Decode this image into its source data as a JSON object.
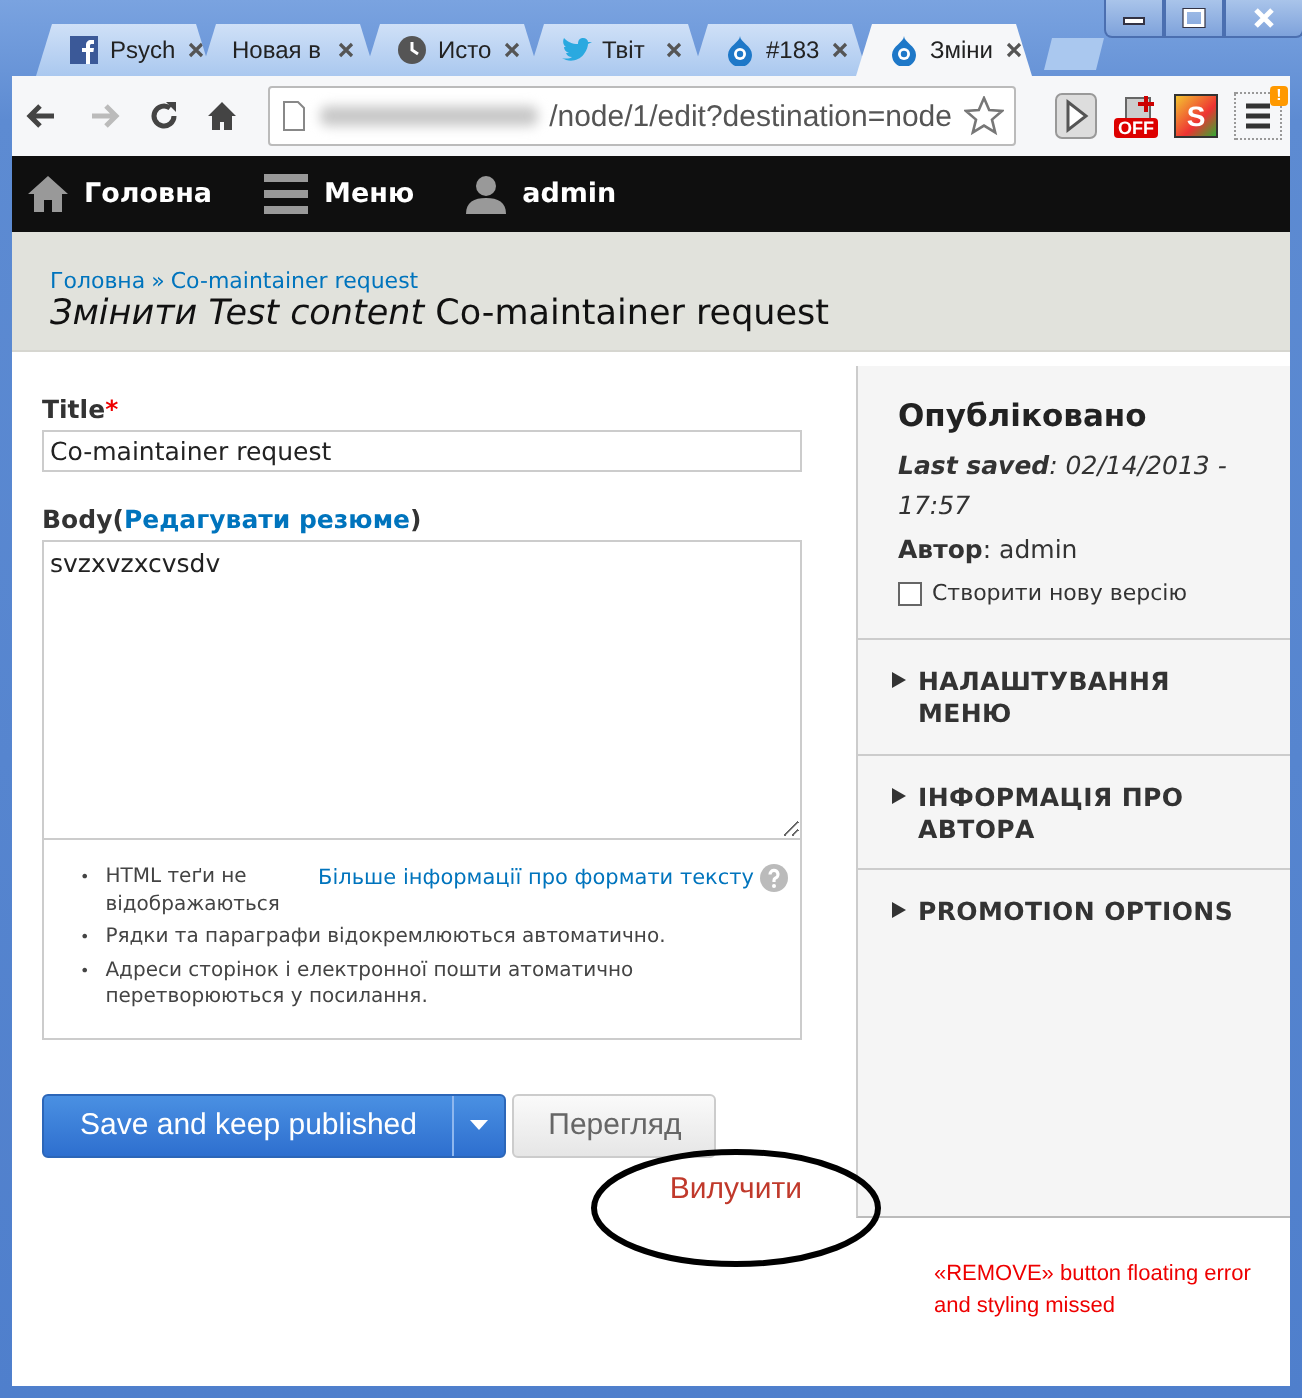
{
  "tabs": [
    {
      "label": "Psych",
      "kind": "facebook",
      "selected": false
    },
    {
      "label": "Новая в",
      "kind": "plain",
      "selected": false
    },
    {
      "label": "Исто",
      "kind": "clock",
      "selected": false
    },
    {
      "label": "Твіт",
      "kind": "bird",
      "selected": false
    },
    {
      "label": "#183",
      "kind": "drop",
      "selected": false
    },
    {
      "label": "Зміни",
      "kind": "drop",
      "selected": true
    }
  ],
  "nav": [
    {
      "kind": "back",
      "disabled": false
    },
    {
      "kind": "forward",
      "disabled": true
    },
    {
      "kind": "reload",
      "disabled": false
    },
    {
      "kind": "home",
      "disabled": false
    }
  ],
  "address": {
    "value": "/node/1/edit?destination=node"
  },
  "extensions": [
    {
      "kind": "play"
    },
    {
      "kind": "off",
      "label": "OFF"
    },
    {
      "kind": "s",
      "label": "S"
    },
    {
      "kind": "menu",
      "label": "!"
    }
  ],
  "admin_bar": [
    {
      "kind": "home",
      "label": "Головна"
    },
    {
      "kind": "menu",
      "label": "Меню"
    },
    {
      "kind": "user",
      "label": "admin"
    }
  ],
  "breadcrumb": {
    "items": [
      "Головна",
      "Co-maintainer request"
    ],
    "separator": "»"
  },
  "page_title": "*Змінити Test content* Co-maintainer request",
  "title_field": {
    "label": "Title",
    "required_mark": "*",
    "value": "Co-maintainer request"
  },
  "body_field": {
    "label_before": "Body(",
    "link": "Редагувати резюме",
    "label_after": ")",
    "value": "svzxvzxcvsdv"
  },
  "filter_tips": {
    "bullet": "•",
    "items": [
      "HTML теґи не відображаються",
      "Рядки та параграфи відокремлюються автоматично.",
      "Адреси сторінок і електронної пошти атоматично перетворюються у посилання."
    ],
    "help_link": "Більше інформації про формати тексту"
  },
  "actions": {
    "primary": "Save and keep published",
    "preview": "Перегляд",
    "delete": "Вилучити"
  },
  "sidebar": {
    "status": "Опубліковано",
    "last_saved": "**Last saved**: 02/14/2013 - 17:57",
    "author": "**Автор**: admin",
    "new_revision": {
      "label": "Створити нову версію",
      "checked": false
    },
    "sections": [
      {
        "label": "НАЛАШТУВАННЯ МЕНЮ",
        "expanded": false
      },
      {
        "label": "ІНФОРМАЦІЯ ПРО АВТОРА",
        "expanded": false
      },
      {
        "label": "PROMOTION OPTIONS",
        "expanded": false
      }
    ]
  },
  "annotation": {
    "text": "«REMOVE» button floating error and styling missed"
  }
}
